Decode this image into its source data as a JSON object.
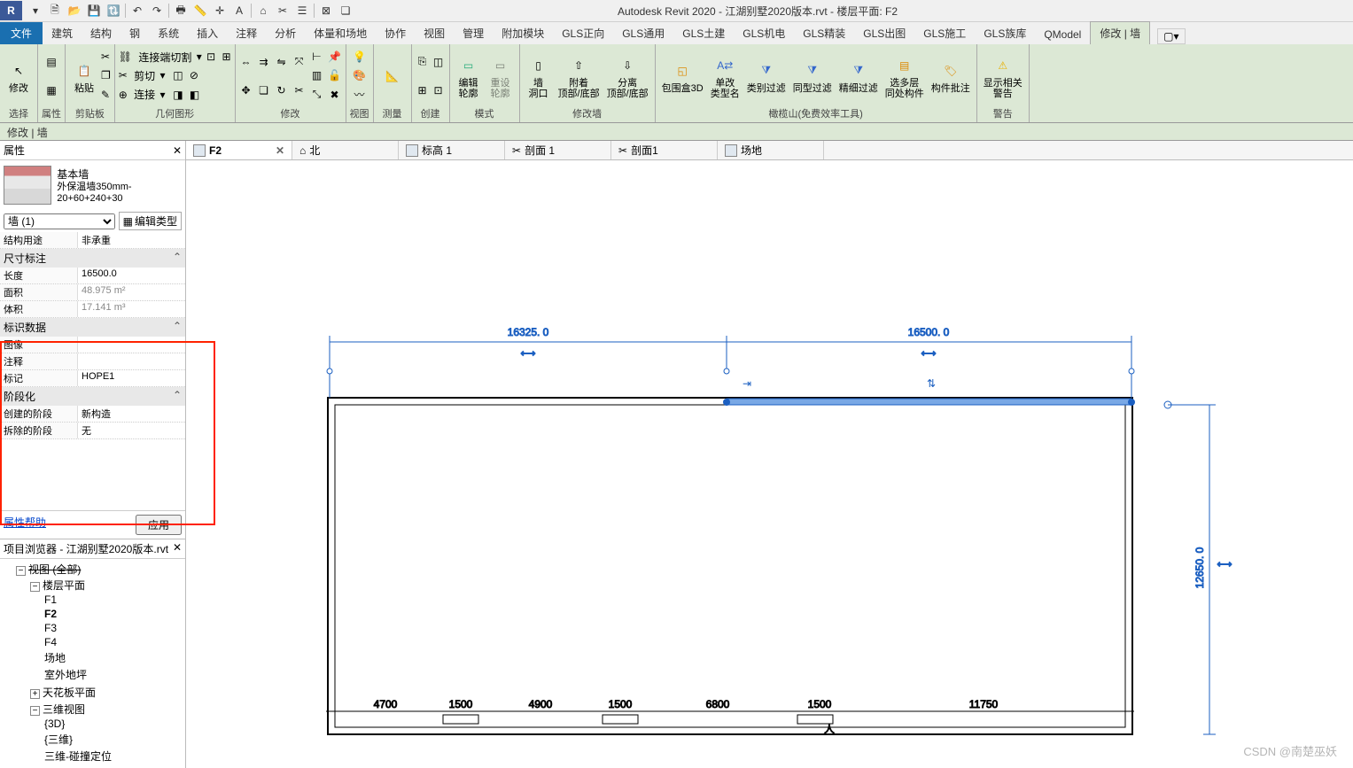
{
  "title": "Autodesk Revit 2020 - 江湖别墅2020版本.rvt - 楼层平面: F2",
  "menubar": {
    "file": "文件",
    "tabs": [
      "建筑",
      "结构",
      "钢",
      "系统",
      "插入",
      "注释",
      "分析",
      "体量和场地",
      "协作",
      "视图",
      "管理",
      "附加模块",
      "GLS正向",
      "GLS通用",
      "GLS土建",
      "GLS机电",
      "GLS精装",
      "GLS出图",
      "GLS施工",
      "GLS族库",
      "QModel",
      "修改 | 墙"
    ]
  },
  "ribbon": {
    "panels": {
      "select": "选择",
      "properties": "属性",
      "clipboard": "剪贴板",
      "geometry": "几何图形",
      "modify": "修改",
      "view": "视图",
      "measure": "测量",
      "create": "创建",
      "mode": "模式",
      "modifywall": "修改墙",
      "olive": "橄榄山(免费效率工具)",
      "warn": "警告"
    },
    "btns": {
      "modify": "修改",
      "paste": "粘贴",
      "join_cut": "连接端切割",
      "cut": "剪切",
      "join": "连接",
      "edit_profile": "编辑\n轮廓",
      "reset_profile": "重设\n轮廓",
      "wall_opening": "墙\n洞口",
      "attach": "附着\n顶部/底部",
      "detach": "分离\n顶部/底部",
      "bb3d": "包围盒3D",
      "single_type": "单改\n类型名",
      "cat_filter": "类别过滤",
      "type_filter": "同型过滤",
      "fine_filter": "精细过滤",
      "multi_floor": "选多层\n同处构件",
      "batch_annot": "构件批注",
      "show_warn": "显示相关\n警告"
    }
  },
  "context_bar": "修改 | 墙",
  "viewtabs": [
    {
      "label": "F2",
      "active": true,
      "close": true
    },
    {
      "label": "北",
      "icon": "elev"
    },
    {
      "label": "标高 1",
      "icon": "elev"
    },
    {
      "label": "剖面 1",
      "icon": "section"
    },
    {
      "label": "剖面1",
      "icon": "section"
    },
    {
      "label": "场地",
      "icon": "plan"
    }
  ],
  "properties": {
    "title": "属性",
    "family": "基本墙",
    "type": "外保温墙350mm- 20+60+240+30",
    "type_selector": "墙 (1)",
    "edit_type": "编辑类型",
    "rows": {
      "struct_use_k": "结构用途",
      "struct_use_v": "非承重",
      "dim_group": "尺寸标注",
      "length_k": "长度",
      "length_v": "16500.0",
      "area_k": "面积",
      "area_v": "48.975 m²",
      "volume_k": "体积",
      "volume_v": "17.141 m³",
      "id_group": "标识数据",
      "image_k": "图像",
      "image_v": "",
      "comment_k": "注释",
      "comment_v": "",
      "mark_k": "标记",
      "mark_v": "HOPE1",
      "phase_group": "阶段化",
      "create_k": "创建的阶段",
      "create_v": "新构造",
      "demo_k": "拆除的阶段",
      "demo_v": "无"
    },
    "help": "属性帮助",
    "apply": "应用"
  },
  "browser": {
    "title": "项目浏览器 - 江湖别墅2020版本.rvt",
    "tree": {
      "root": "视图 (全部)",
      "floor": "楼层平面",
      "floors": [
        "F1",
        "F2",
        "F3",
        "F4",
        "场地",
        "室外地坪"
      ],
      "ceiling": "天花板平面",
      "threeD": "三维视图",
      "threeDs": [
        "{3D}",
        "{三维}",
        "三维-碰撞定位"
      ]
    }
  },
  "canvas": {
    "dim_top_left": "16325. 0",
    "dim_top_right": "16500. 0",
    "dim_right": "12650. 0",
    "dims_bottom": [
      "4700",
      "1500",
      "4900",
      "1500",
      "6800",
      "1500",
      "11750"
    ]
  },
  "watermark": "CSDN @南楚巫妖"
}
